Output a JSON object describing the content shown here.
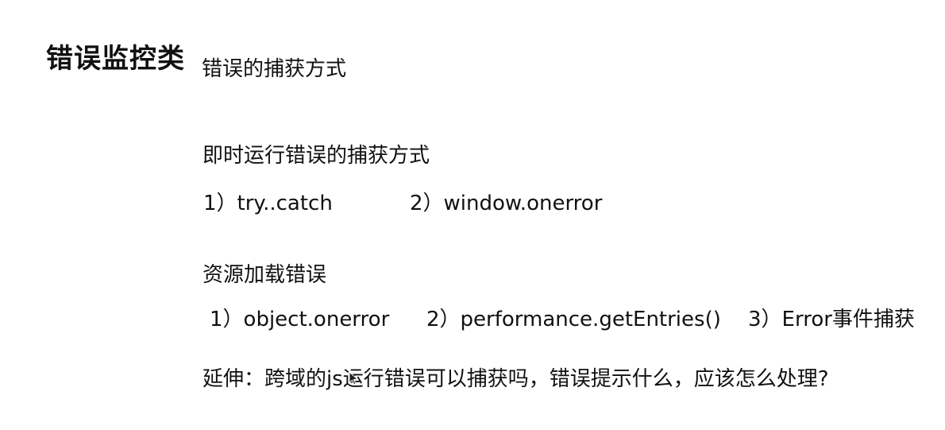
{
  "title": "错误监控类",
  "subtitle": "错误的捕获方式",
  "runtime_section": {
    "heading": "即时运行错误的捕获方式",
    "items": [
      "1）try..catch",
      "2）window.onerror"
    ]
  },
  "resource_section": {
    "heading": "资源加载错误",
    "items": [
      "1）object.onerror",
      "2）performance.getEntries()",
      "3）Error事件捕获"
    ]
  },
  "extension": "延伸：跨域的js运行错误可以捕获吗，错误提示什么，应该怎么处理?"
}
